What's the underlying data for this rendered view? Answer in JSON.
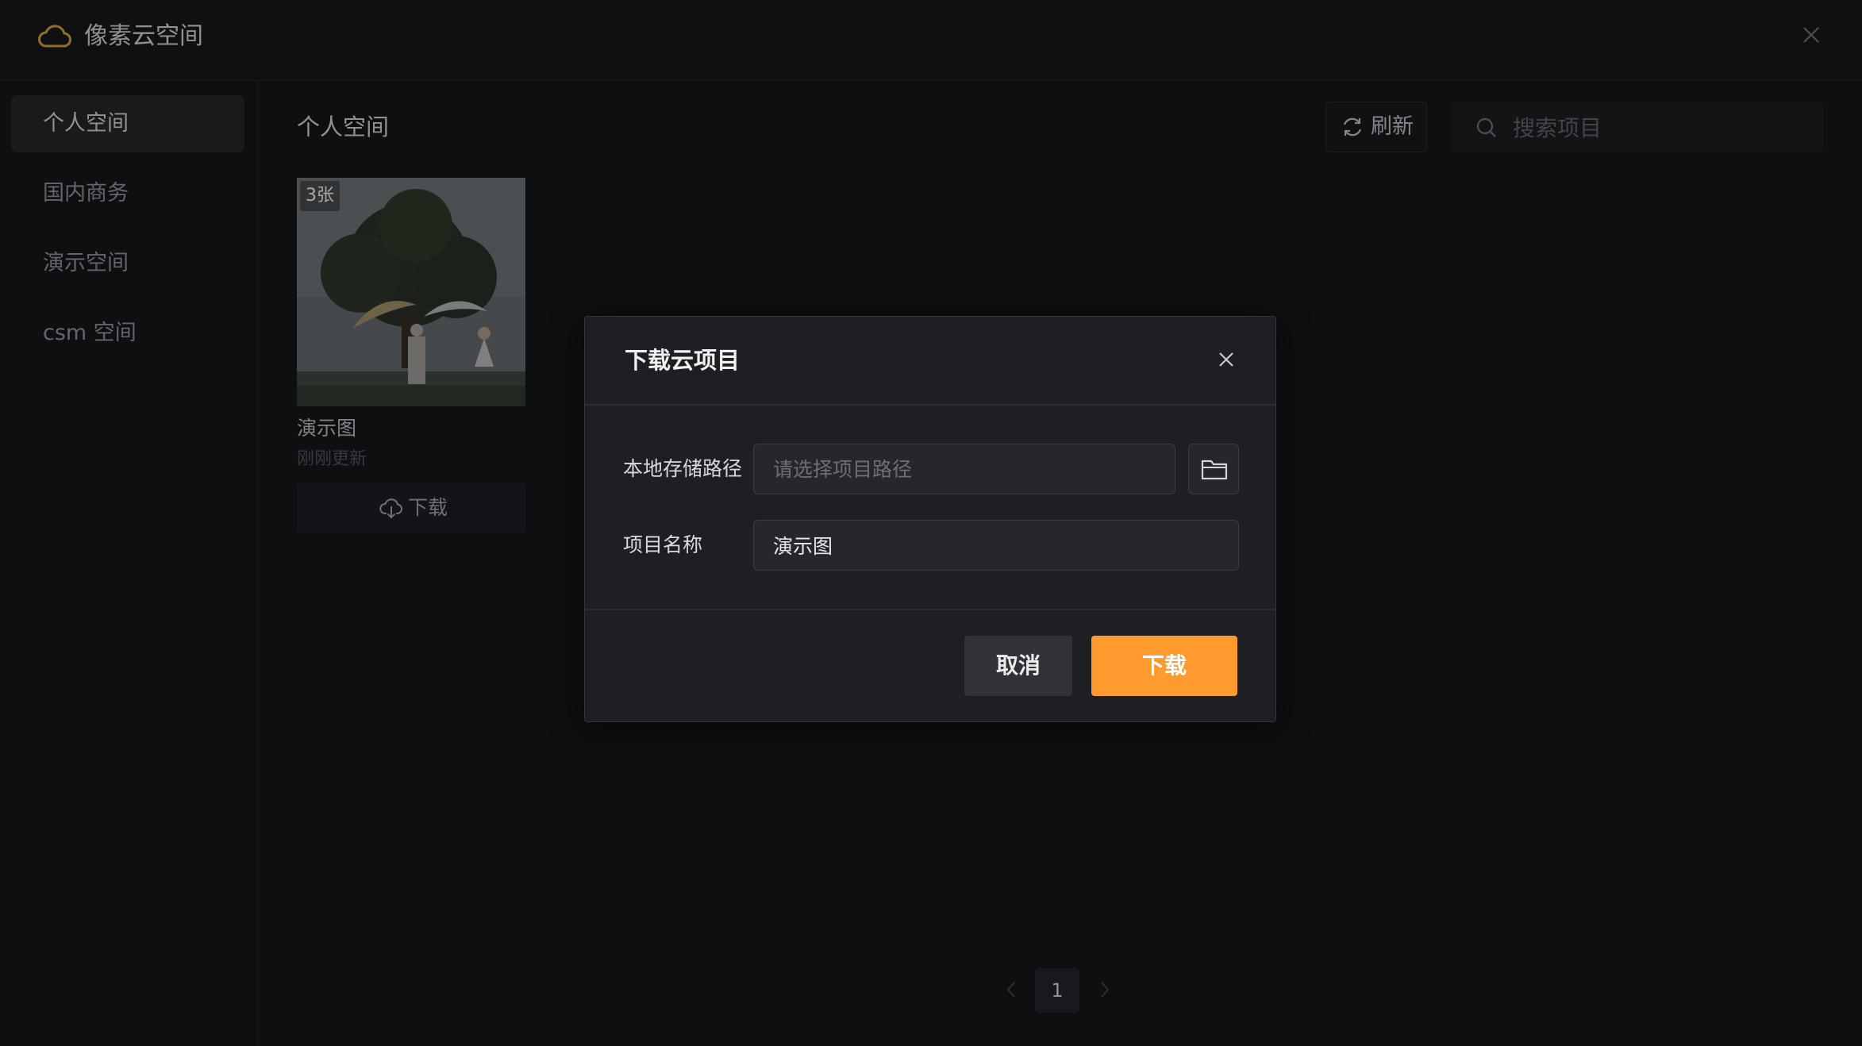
{
  "app": {
    "title": "像素云空间",
    "brand_color": "#c99a3c"
  },
  "sidebar": {
    "items": [
      {
        "label": "个人空间",
        "active": true
      },
      {
        "label": "国内商务",
        "active": false
      },
      {
        "label": "演示空间",
        "active": false
      },
      {
        "label": "csm 空间",
        "active": false
      }
    ]
  },
  "main": {
    "title": "个人空间",
    "refresh_label": "刷新",
    "refresh_icon": "refresh-icon",
    "search": {
      "placeholder": "搜索项目",
      "value": "",
      "icon": "search-icon"
    }
  },
  "projects": [
    {
      "badge": "3张",
      "name": "演示图",
      "updated": "刚刚更新",
      "download_label": "下载",
      "download_icon": "cloud-download-icon"
    }
  ],
  "pagination": {
    "current": "1"
  },
  "dialog": {
    "title": "下载云项目",
    "path_label": "本地存储路径",
    "path_placeholder": "请选择项目路径",
    "path_value": "",
    "folder_icon": "folder-icon",
    "name_label": "项目名称",
    "name_value": "演示图",
    "cancel_label": "取消",
    "confirm_label": "下载",
    "confirm_color": "#ff9a2e"
  }
}
